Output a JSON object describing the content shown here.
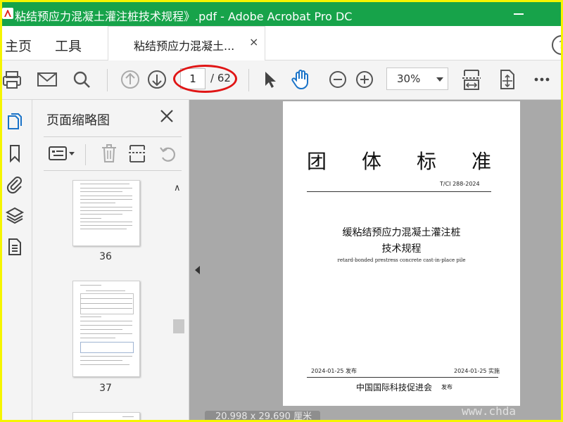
{
  "window": {
    "title": "粘结预应力混凝土灌注桩技术规程》.pdf - Adobe Acrobat Pro DC"
  },
  "tabs": {
    "home": "主页",
    "tools": "工具",
    "document": "粘结预应力混凝土...",
    "close": "×",
    "help": "?"
  },
  "toolbar": {
    "current_page": "1",
    "total_pages": "/ 62",
    "zoom": "30%"
  },
  "thumbnail_panel": {
    "title": "页面缩略图",
    "pages": [
      {
        "number": "36"
      },
      {
        "number": "37"
      }
    ]
  },
  "document": {
    "standard_title_chars": [
      "团",
      "体",
      "标",
      "准"
    ],
    "standard_code": "T/CI 288-2024",
    "name_line1": "缓粘结预应力混凝土灌注桩",
    "name_line2": "技术规程",
    "english_name": "retard-bonded prestress concrete cast-in-place pile",
    "publish_date": "2024-01-25 发布",
    "implement_date": "2024-01-25 实施",
    "publisher": "中国国际科技促进会",
    "publisher_suffix": "发布"
  },
  "status": {
    "page_size": "20.998 x 29.690 厘米"
  },
  "watermark": "www.chda",
  "colors": {
    "titlebar": "#17a34a",
    "accent_blue": "#1a73c8",
    "highlight_red": "#e01515",
    "frame_yellow": "#f5f500"
  },
  "icons": [
    "print-icon",
    "mail-icon",
    "search-icon",
    "page-up-icon",
    "page-down-icon",
    "cursor-icon",
    "hand-icon",
    "zoom-out-icon",
    "zoom-in-icon",
    "fit-width-icon",
    "fit-page-icon",
    "more-icon",
    "pages-icon",
    "bookmark-icon",
    "attachment-icon",
    "layers-icon",
    "document-icon",
    "options-icon",
    "trash-icon",
    "crop-pages-icon",
    "rotate-icon",
    "close-icon"
  ]
}
